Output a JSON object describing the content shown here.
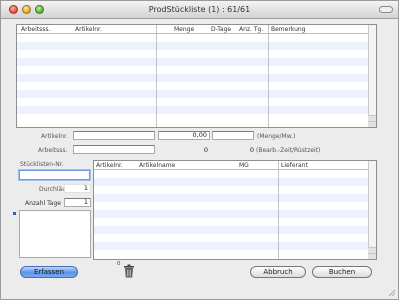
{
  "window": {
    "title": "ProdStückliste (1) : 61/61"
  },
  "table_top": {
    "columns": [
      "Arbeitsss.",
      "Artikelnr.",
      "Menge",
      "D-Tage",
      "Anz. Tg.",
      "Bemerkung"
    ]
  },
  "fields": {
    "artikelnr_label": "Artikelnr.",
    "artikelnr_value": "",
    "artikel_menge_value": "0,00",
    "menge_einheit": "(Menge/Mw.)",
    "arbeitsss_label": "Arbeitsss.",
    "arbeitsss_value": "",
    "arbeitsss_zeit_value": "0",
    "bearb_zeit_label": "(Bearb.-Zeit/Rüstzeit)"
  },
  "left_panel": {
    "stueckliste_label": "Stücklisten-Nr.",
    "stueckliste_value": "",
    "durchlaufe_label": "Durchläufe",
    "durchlaufe_value": "1",
    "anzahl_tage_label": "Anzahl Tage",
    "anzahl_tage_value": "1"
  },
  "table_bottom": {
    "columns": [
      "Artikelnr.",
      "Artikelname",
      "MG",
      "Lieferant"
    ]
  },
  "footer": {
    "erfassen_label": "Erfassen",
    "count": "0",
    "abbruch_label": "Abbruch",
    "buchen_label": "Buchen"
  },
  "icons": {
    "trash": "trash-icon",
    "resize": "resize-grip-icon"
  },
  "colors": {
    "accent": "#5c93e7",
    "row_alt": "#edf3fe"
  }
}
